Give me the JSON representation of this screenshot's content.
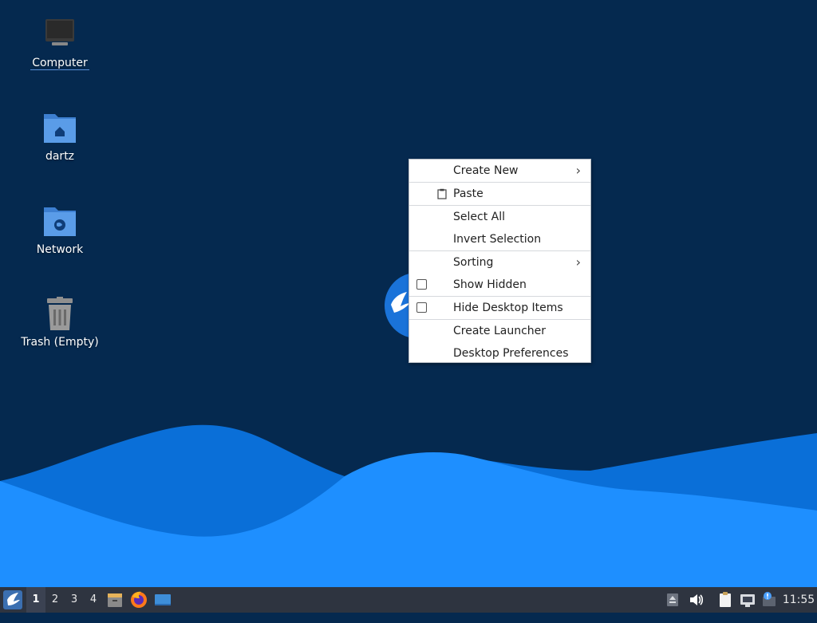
{
  "desktop": {
    "icons": [
      {
        "label": "Computer",
        "icon": "computer-icon"
      },
      {
        "label": "dartz",
        "icon": "home-folder-icon"
      },
      {
        "label": "Network",
        "icon": "network-folder-icon"
      },
      {
        "label": "Trash (Empty)",
        "icon": "trash-icon"
      }
    ]
  },
  "context_menu": {
    "items": [
      {
        "label": "Create New",
        "submenu": true
      },
      {
        "label": "Paste",
        "icon": "paste-icon"
      },
      {
        "label": "Select All"
      },
      {
        "label": "Invert Selection"
      },
      {
        "label": "Sorting",
        "submenu": true
      },
      {
        "label": "Show Hidden",
        "checkbox": false
      },
      {
        "label": "Hide Desktop Items",
        "checkbox": false
      },
      {
        "label": "Create Launcher"
      },
      {
        "label": "Desktop Preferences"
      }
    ]
  },
  "taskbar": {
    "workspaces": [
      "1",
      "2",
      "3",
      "4"
    ],
    "active_workspace": "1",
    "clock": "11:55",
    "launchers": [
      "file-manager-icon",
      "firefox-icon",
      "desktop-icon"
    ],
    "tray": [
      "eject-icon",
      "volume-icon",
      "clipboard-icon",
      "network-icon",
      "updates-icon"
    ]
  },
  "colors": {
    "background": "#05294f",
    "wave_light": "#1e8fff",
    "wave_dark": "#0a6fd8",
    "taskbar": "#2e3440",
    "menu_bg": "#ffffff"
  }
}
